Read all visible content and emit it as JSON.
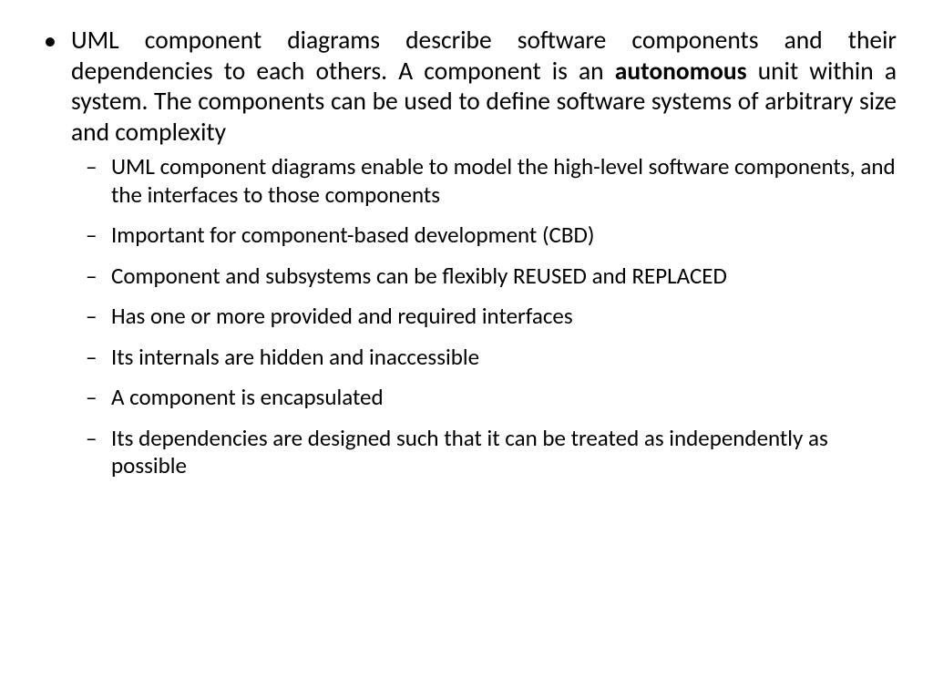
{
  "slide": {
    "main": {
      "pre": "UML component diagrams describe software components and their dependencies to each others. A component is an ",
      "bold": "autonomous",
      "post": " unit within a system. The components can be used to define software systems of arbitrary size and complexity"
    },
    "sub": [
      "UML component diagrams enable to model the high-level software components, and the interfaces to those components",
      "Important for component-based development (CBD)",
      "Component and subsystems can be flexibly REUSED and REPLACED",
      "Has one or more provided and required interfaces",
      "Its internals are hidden and inaccessible",
      "A component is encapsulated",
      "Its dependencies are designed such that it can be treated as independently as possible"
    ]
  }
}
